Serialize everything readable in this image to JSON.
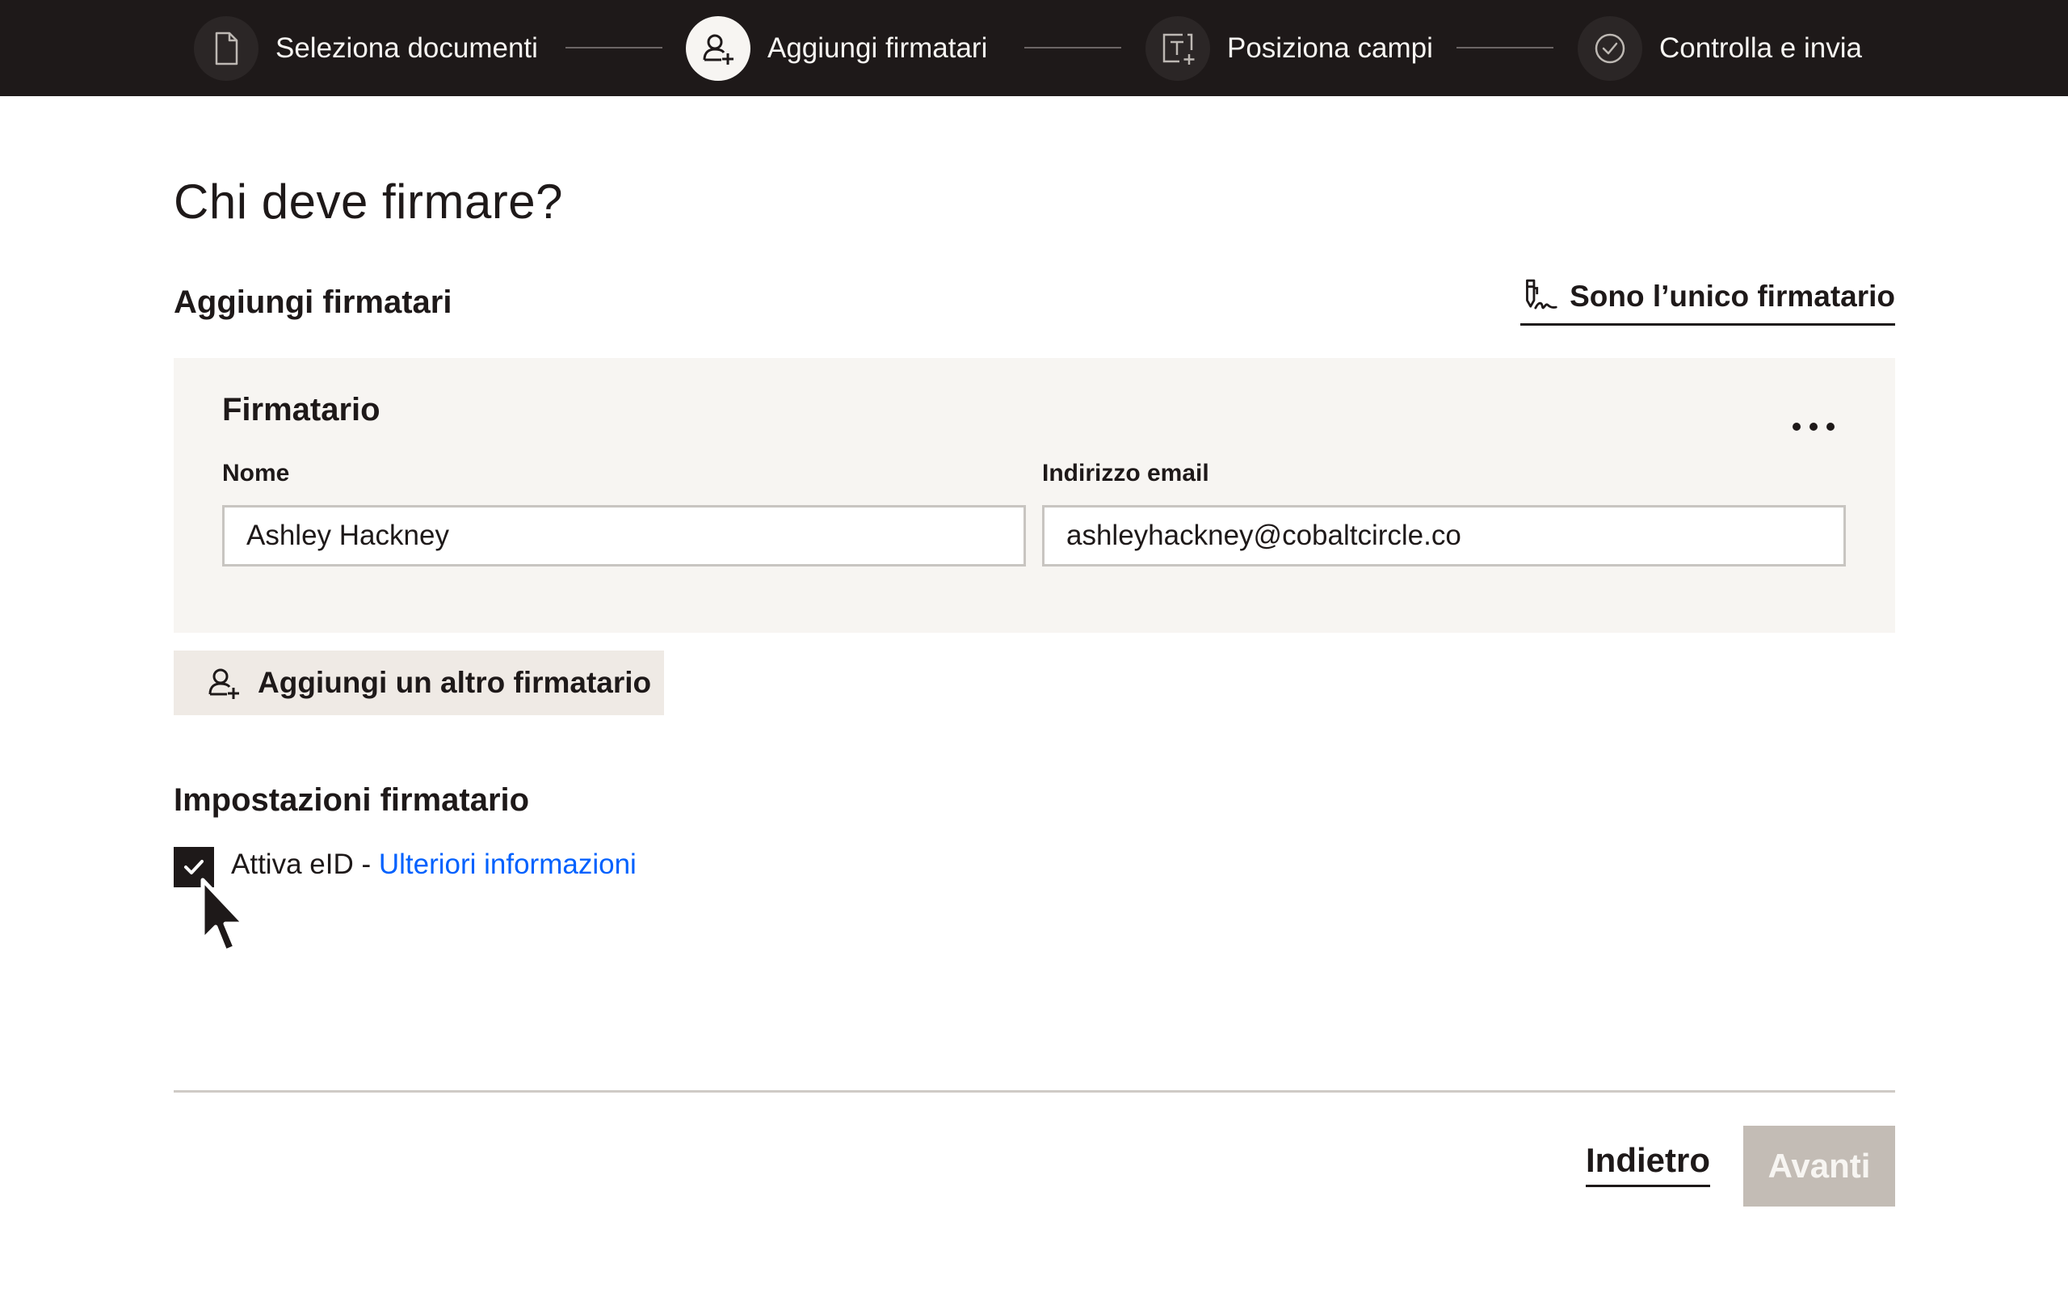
{
  "stepper": {
    "steps": [
      {
        "label": "Seleziona documenti",
        "icon": "document-icon",
        "state": "inactive"
      },
      {
        "label": "Aggiungi firmatari",
        "icon": "person-add-icon",
        "state": "active"
      },
      {
        "label": "Posiziona campi",
        "icon": "text-field-add-icon",
        "state": "inactive"
      },
      {
        "label": "Controlla e invia",
        "icon": "check-circle-icon",
        "state": "inactive"
      }
    ]
  },
  "page": {
    "title": "Chi deve firmare?"
  },
  "signers_section": {
    "title": "Aggiungi firmatari",
    "sole_signer_label": "Sono l’unico firmatario",
    "sole_signer_icon": "signature-pen-icon"
  },
  "signer_card": {
    "title": "Firmatario",
    "more_icon": "more-horizontal-icon",
    "name_label": "Nome",
    "name_value": "Ashley Hackney",
    "email_label": "Indirizzo email",
    "email_value": "ashleyhackney@cobaltcircle.co"
  },
  "add_signer": {
    "label": "Aggiungi un altro firmatario",
    "icon": "person-add-icon"
  },
  "settings": {
    "title": "Impostazioni firmatario",
    "eid_label": "Attiva eID - ",
    "eid_link": "Ulteriori informazioni",
    "eid_checked": true
  },
  "footer": {
    "back_label": "Indietro",
    "next_label": "Avanti"
  },
  "colors": {
    "topbar": "#1e1919",
    "card_background": "#f7f5f2",
    "link": "#0061fe",
    "next_disabled": "#c3bcb5",
    "secondary_button": "#efeae5"
  }
}
